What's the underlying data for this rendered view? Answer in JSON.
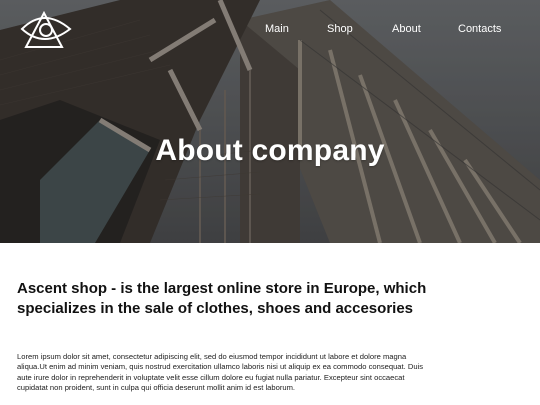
{
  "header": {
    "logo_icon": "eye-triangle-logo-icon",
    "nav": [
      {
        "label": "Main"
      },
      {
        "label": "Shop"
      },
      {
        "label": "About"
      },
      {
        "label": "Contacts"
      }
    ]
  },
  "hero": {
    "title": "About company"
  },
  "main": {
    "headline": "Ascent shop - is the largest online store in Europe, which specializes in the sale of clothes, shoes and accesories",
    "body": "Lorem ipsum dolor sit amet, consectetur adipiscing elit, sed do eiusmod tempor incididunt ut labore et dolore magna aliqua.Ut enim ad minim veniam, quis nostrud exercitation ullamco laboris nisi ut aliquip ex ea commodo consequat. Duis aute irure dolor in reprehenderit in voluptate velit esse cillum dolore eu fugiat nulla pariatur. Excepteur sint occaecat cupidatat non proident, sunt in culpa qui officia deserunt mollit anim id est laborum."
  },
  "colors": {
    "nav_text": "#ffffff",
    "hero_overlay": "#3e3f41",
    "page_background": "#ffffff",
    "heading_text": "#111111"
  }
}
